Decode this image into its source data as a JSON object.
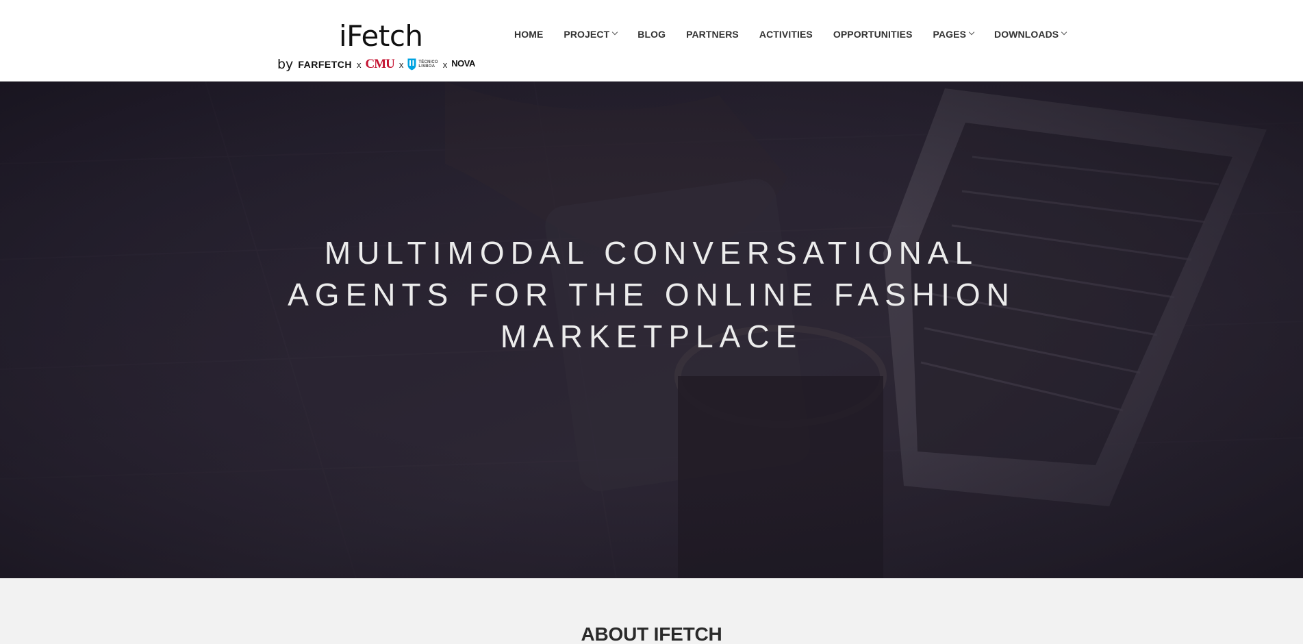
{
  "brand": {
    "title": "iFetch",
    "by": "by",
    "partners": [
      "FARFETCH",
      "CMU",
      "TÉCNICO LISBOA",
      "NOVA"
    ],
    "separator": "x"
  },
  "nav": {
    "items": [
      {
        "label": "HOME",
        "dropdown": false
      },
      {
        "label": "PROJECT",
        "dropdown": true
      },
      {
        "label": "BLOG",
        "dropdown": false
      },
      {
        "label": "PARTNERS",
        "dropdown": false
      },
      {
        "label": "ACTIVITIES",
        "dropdown": false
      },
      {
        "label": "OPPORTUNITIES",
        "dropdown": false
      },
      {
        "label": "PAGES",
        "dropdown": true
      },
      {
        "label": "DOWNLOADS",
        "dropdown": true
      }
    ]
  },
  "hero": {
    "lines": [
      "MULTIMODAL CONVERSATIONAL",
      "AGENTS FOR THE ONLINE FASHION",
      "MARKETPLACE"
    ]
  },
  "about": {
    "title": "ABOUT IFETCH"
  },
  "colors": {
    "header_bg": "#ffffff",
    "hero_overlay": "#1c1826",
    "cmu_red": "#c41230",
    "tecnico_blue": "#00a3e0",
    "section_bg": "#f2f2f2"
  }
}
